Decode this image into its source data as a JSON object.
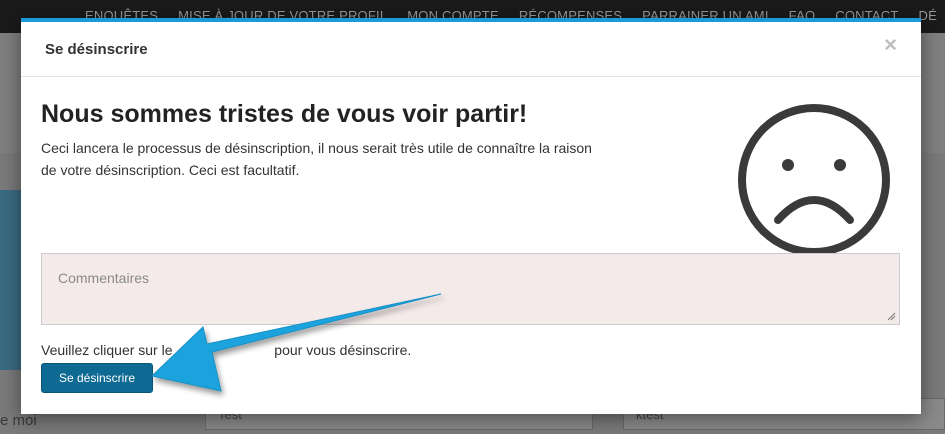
{
  "background": {
    "nav_items": [
      "ENQUÊTES",
      "MISE À JOUR DE VOTRE PROFIL",
      "MON COMPTE",
      "RÉCOMPENSES",
      "PARRAINER UN AMI",
      "FAQ",
      "CONTACT",
      "DÉ"
    ],
    "input_left_value": "Test",
    "input_right_value": "ktest",
    "side_text_left": "e moi"
  },
  "modal": {
    "title": "Se désinscrire",
    "close_label": "×",
    "heading": "Nous sommes tristes de vous voir partir!",
    "description": "Ceci lancera le processus de désinscription, il nous serait très utile de connaître la raison de votre désinscription. Ceci est facultatif.",
    "comment_placeholder": "Commentaires",
    "comment_value": "",
    "instruction_start": "Veuillez cliquer sur le",
    "instruction_end": "pour vous désinscrire.",
    "unsubscribe_button": "Se désinscrire",
    "sad_face_icon": "sad-face-icon"
  },
  "colors": {
    "accent": "#1a9ad6",
    "button": "#0e6a93",
    "arrow": "#1ea3dd",
    "textarea_bg": "#f5eaea"
  }
}
